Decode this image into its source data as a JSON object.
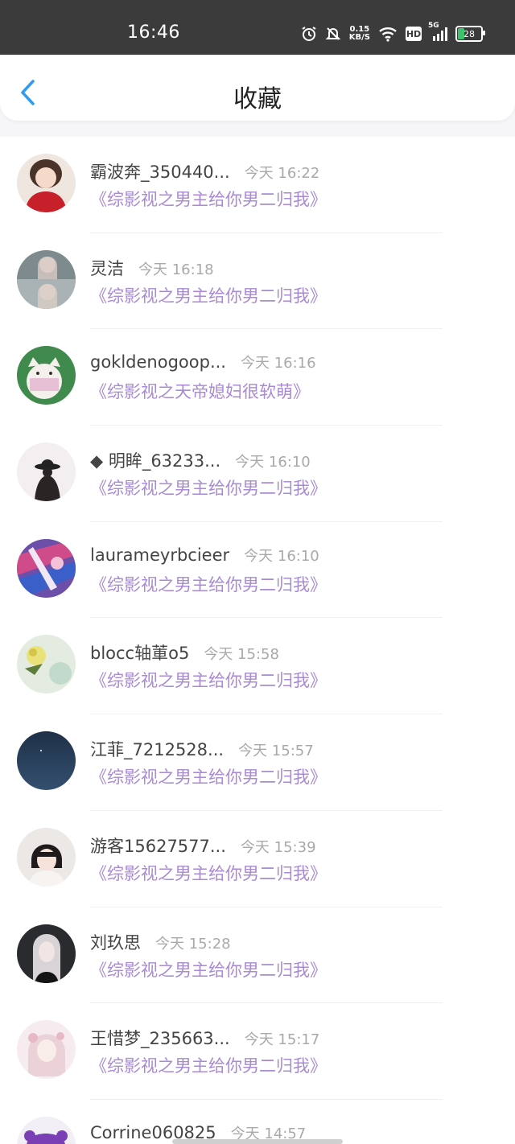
{
  "status_bar": {
    "time": "16:46",
    "speed_value": "0.15",
    "speed_unit": "KB/S",
    "hd": "HD",
    "network": "5G",
    "battery": "28"
  },
  "header": {
    "title": "收藏"
  },
  "items": [
    {
      "name": "霸波奔_350440...",
      "time": "今天 16:22",
      "book": "《综影视之男主给你男二归我》"
    },
    {
      "name": "灵洁",
      "time": "今天 16:18",
      "book": "《综影视之男主给你男二归我》"
    },
    {
      "name": "gokldenogoop...",
      "time": "今天 16:16",
      "book": "《综影视之天帝媳妇很软萌》"
    },
    {
      "name": "◆ 明眸_63233...",
      "time": "今天 16:10",
      "book": "《综影视之男主给你男二归我》"
    },
    {
      "name": "laurameyrbcieer",
      "time": "今天 16:10",
      "book": "《综影视之男主给你男二归我》"
    },
    {
      "name": "blocc轴莗o5",
      "time": "今天 15:58",
      "book": "《综影视之男主给你男二归我》"
    },
    {
      "name": "江菲_7212528...",
      "time": "今天 15:57",
      "book": "《综影视之男主给你男二归我》"
    },
    {
      "name": "游客15627577...",
      "time": "今天 15:39",
      "book": "《综影视之男主给你男二归我》"
    },
    {
      "name": "刘玖思",
      "time": "今天 15:28",
      "book": "《综影视之男主给你男二归我》"
    },
    {
      "name": "王惜梦_235663...",
      "time": "今天 15:17",
      "book": "《综影视之男主给你男二归我》"
    },
    {
      "name": "Corrine060825",
      "time": "今天 14:57",
      "book": ""
    }
  ]
}
